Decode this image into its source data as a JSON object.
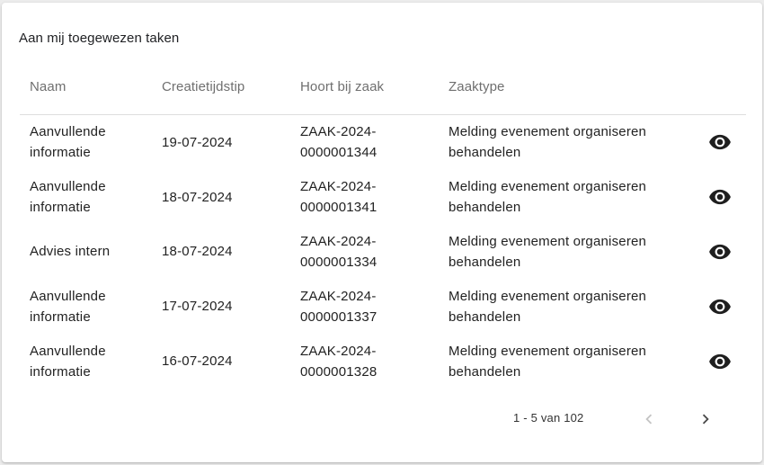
{
  "card": {
    "title": "Aan mij toegewezen taken"
  },
  "table": {
    "columns": [
      "Naam",
      "Creatietijdstip",
      "Hoort bij zaak",
      "Zaaktype"
    ],
    "rows": [
      {
        "naam": "Aanvullende informatie",
        "datum": "19-07-2024",
        "zaak": "ZAAK-2024-0000001344",
        "zaaktype": "Melding evenement organiseren behandelen",
        "action_icon": "eye-icon"
      },
      {
        "naam": "Aanvullende informatie",
        "datum": "18-07-2024",
        "zaak": "ZAAK-2024-0000001341",
        "zaaktype": "Melding evenement organiseren behandelen",
        "action_icon": "eye-icon"
      },
      {
        "naam": "Advies intern",
        "datum": "18-07-2024",
        "zaak": "ZAAK-2024-0000001334",
        "zaaktype": "Melding evenement organiseren behandelen",
        "action_icon": "eye-icon"
      },
      {
        "naam": "Aanvullende informatie",
        "datum": "17-07-2024",
        "zaak": "ZAAK-2024-0000001337",
        "zaaktype": "Melding evenement organiseren behandelen",
        "action_icon": "eye-icon"
      },
      {
        "naam": "Aanvullende informatie",
        "datum": "16-07-2024",
        "zaak": "ZAAK-2024-0000001328",
        "zaaktype": "Melding evenement organiseren behandelen",
        "action_icon": "eye-icon"
      }
    ]
  },
  "paginator": {
    "range_label": "1 - 5 van 102",
    "prev_icon": "chevron-left-icon",
    "next_icon": "chevron-right-icon",
    "prev_disabled": true
  },
  "colors": {
    "icon": "#1f1f1f",
    "icon_disabled": "#c4c4c4",
    "header_text": "#6f6f6f",
    "divider": "#dedede"
  }
}
